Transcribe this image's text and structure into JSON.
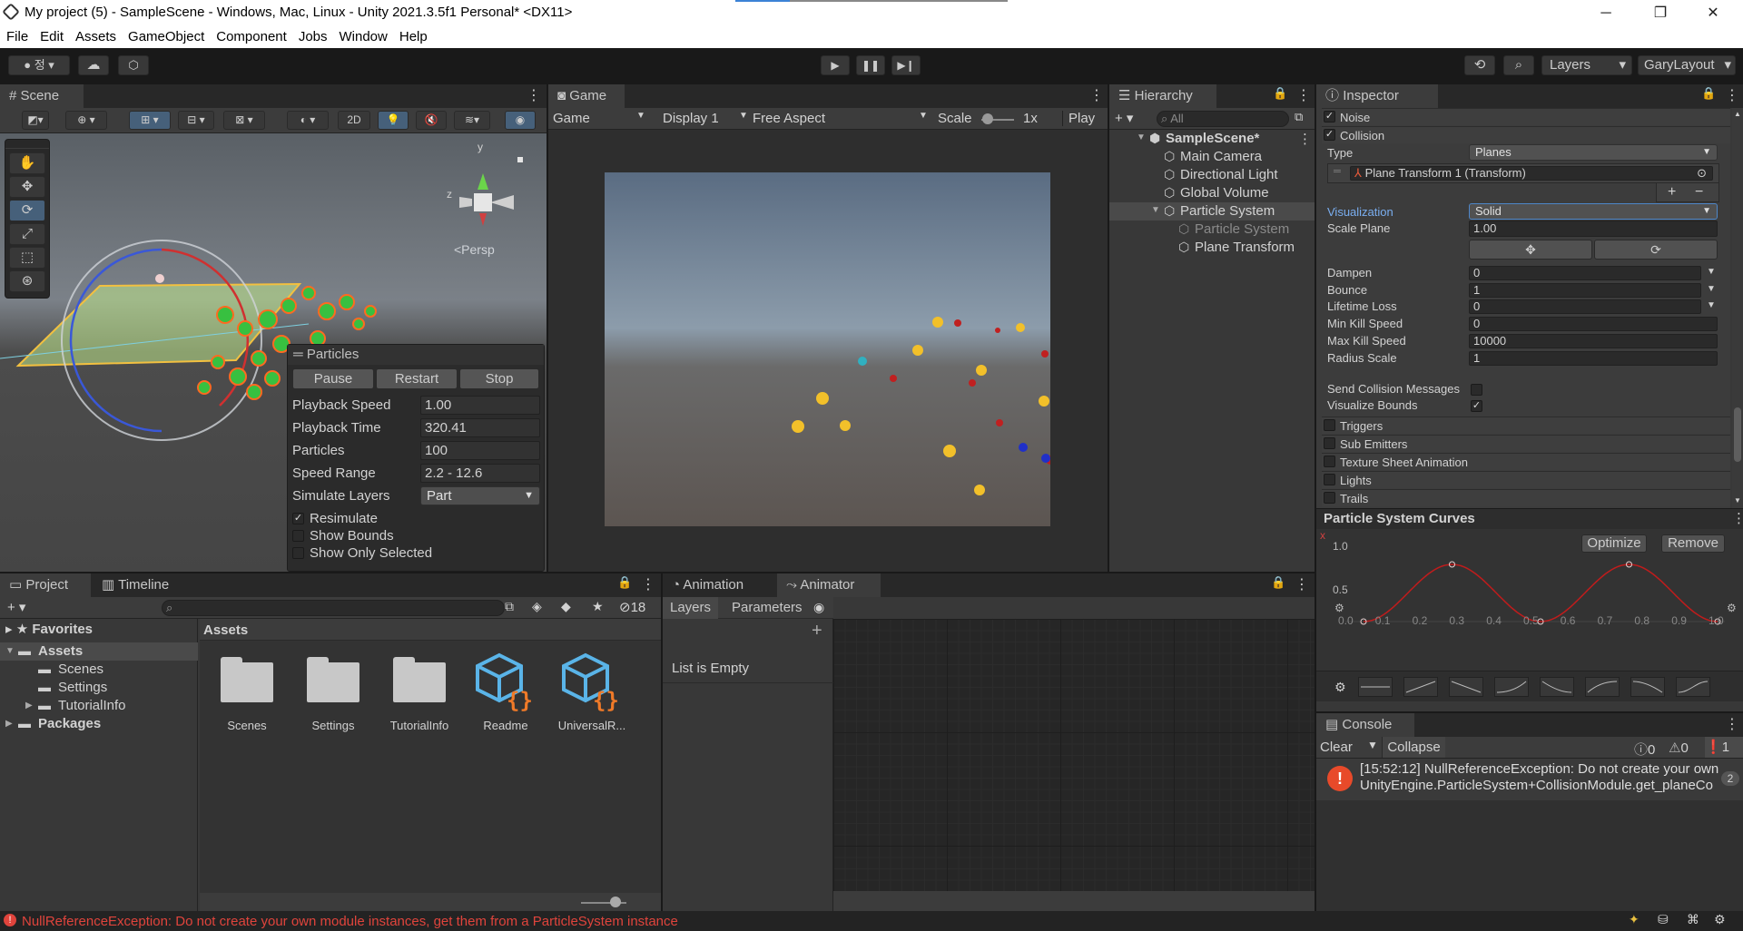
{
  "window": {
    "title": "My project (5) - SampleScene - Windows, Mac, Linux - Unity 2021.3.5f1 Personal* <DX11>",
    "minimize": "─",
    "maximize": "❐",
    "close": "✕"
  },
  "menu": [
    "File",
    "Edit",
    "Assets",
    "GameObject",
    "Component",
    "Jobs",
    "Window",
    "Help"
  ],
  "toolbar": {
    "account_label": "정",
    "layers_label": "Layers",
    "layout_label": "GaryLayout"
  },
  "scene": {
    "tab": "Scene",
    "mode_2d": "2D",
    "persp": "<Persp",
    "axis_y": "y",
    "axis_z": "z",
    "particles_overlay": {
      "title": "Particles",
      "buttons": [
        "Pause",
        "Restart",
        "Stop"
      ],
      "rows": [
        {
          "label": "Playback Speed",
          "value": "1.00"
        },
        {
          "label": "Playback Time",
          "value": "320.41"
        },
        {
          "label": "Particles",
          "value": "100"
        },
        {
          "label": "Speed Range",
          "value": "2.2 - 12.6"
        }
      ],
      "simulate_layers_label": "Simulate Layers",
      "simulate_layers_value": "Part",
      "checks": [
        {
          "label": "Resimulate",
          "checked": true
        },
        {
          "label": "Show Bounds",
          "checked": false
        },
        {
          "label": "Show Only Selected",
          "checked": false
        }
      ]
    }
  },
  "game": {
    "tab": "Game",
    "mode": "Game",
    "display": "Display 1",
    "aspect": "Free Aspect",
    "scale_label": "Scale",
    "scale_value": "1x",
    "play_label": "Play"
  },
  "hierarchy": {
    "tab": "Hierarchy",
    "search_placeholder": "All",
    "items": [
      {
        "label": "SampleScene*",
        "level": 0,
        "expanded": true,
        "bold": true,
        "selected": false
      },
      {
        "label": "Main Camera",
        "level": 1,
        "expanded": null,
        "bold": false,
        "selected": false
      },
      {
        "label": "Directional Light",
        "level": 1,
        "expanded": null,
        "bold": false,
        "selected": false
      },
      {
        "label": "Global Volume",
        "level": 1,
        "expanded": null,
        "bold": false,
        "selected": false
      },
      {
        "label": "Particle System",
        "level": 1,
        "expanded": true,
        "bold": false,
        "selected": true
      },
      {
        "label": "Particle System",
        "level": 2,
        "expanded": null,
        "bold": false,
        "selected": false,
        "dim": true
      },
      {
        "label": "Plane Transform",
        "level": 2,
        "expanded": null,
        "bold": false,
        "selected": false
      }
    ]
  },
  "inspector": {
    "tab": "Inspector",
    "modules_top": [
      {
        "label": "Noise",
        "checked": true
      },
      {
        "label": "Collision",
        "checked": true
      }
    ],
    "type_label": "Type",
    "type_value": "Planes",
    "plane_item": "Plane Transform 1 (Transform)",
    "plus": "+",
    "minus": "−",
    "visualization_label": "Visualization",
    "visualization_value": "Solid",
    "scale_plane_label": "Scale Plane",
    "scale_plane_value": "1.00",
    "fields": [
      {
        "label": "Dampen",
        "value": "0",
        "dropdown": true
      },
      {
        "label": "Bounce",
        "value": "1",
        "dropdown": true
      },
      {
        "label": "Lifetime Loss",
        "value": "0",
        "dropdown": true
      },
      {
        "label": "Min Kill Speed",
        "value": "0",
        "dropdown": false
      },
      {
        "label": "Max Kill Speed",
        "value": "10000",
        "dropdown": false
      },
      {
        "label": "Radius Scale",
        "value": "1",
        "dropdown": false
      }
    ],
    "send_collision_label": "Send Collision Messages",
    "send_collision_checked": false,
    "visualize_bounds_label": "Visualize Bounds",
    "visualize_bounds_checked": true,
    "modules_bottom": [
      "Triggers",
      "Sub Emitters",
      "Texture Sheet Animation",
      "Lights",
      "Trails"
    ]
  },
  "curves": {
    "title": "Particle System Curves",
    "x_marker": "x",
    "optimize": "Optimize",
    "remove": "Remove",
    "y_ticks": [
      "1.0",
      "0.5"
    ],
    "x_ticks": [
      "0.0",
      "0.1",
      "0.2",
      "0.3",
      "0.4",
      "0.5",
      "0.6",
      "0.7",
      "0.8",
      "0.9",
      "1.0"
    ],
    "curve_color": "#c01c1c"
  },
  "console": {
    "tab": "Console",
    "clear": "Clear",
    "collapse": "Collapse",
    "count_log": "0",
    "count_warn": "0",
    "count_error": "1",
    "message_line1": "[15:52:12] NullReferenceException: Do not create your own",
    "message_line2": "UnityEngine.ParticleSystem+CollisionModule.get_planeCo",
    "badge": "2"
  },
  "project": {
    "tabs": [
      "Project",
      "Timeline"
    ],
    "hidden_count": "18",
    "favorites": "Favorites",
    "tree": [
      {
        "label": "Assets",
        "level": 0,
        "bold": true,
        "expanded": true,
        "selected": true
      },
      {
        "label": "Scenes",
        "level": 1,
        "bold": false,
        "expanded": null,
        "selected": false
      },
      {
        "label": "Settings",
        "level": 1,
        "bold": false,
        "expanded": null,
        "selected": false
      },
      {
        "label": "TutorialInfo",
        "level": 1,
        "bold": false,
        "expanded": false,
        "selected": false
      },
      {
        "label": "Packages",
        "level": 0,
        "bold": true,
        "expanded": false,
        "selected": false
      }
    ],
    "breadcrumb": "Assets",
    "assets": [
      {
        "label": "Scenes",
        "kind": "folder"
      },
      {
        "label": "Settings",
        "kind": "folder"
      },
      {
        "label": "TutorialInfo",
        "kind": "folder"
      },
      {
        "label": "Readme",
        "kind": "script"
      },
      {
        "label": "UniversalR...",
        "kind": "script"
      }
    ]
  },
  "animator": {
    "tabs": [
      "Animation",
      "Animator"
    ],
    "sub_tabs": [
      "Layers",
      "Parameters"
    ],
    "empty": "List is Empty"
  },
  "statusbar": {
    "message": "NullReferenceException: Do not create your own module instances, get them from a ParticleSystem instance",
    "color": "#e0443c"
  }
}
